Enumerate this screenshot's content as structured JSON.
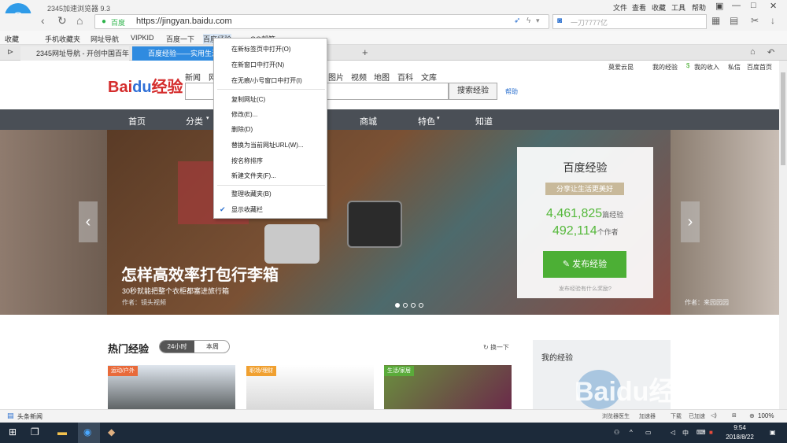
{
  "browser": {
    "title": "2345加速浏览器 9.3",
    "menu": [
      "文件",
      "查看",
      "收藏",
      "工具",
      "帮助"
    ],
    "url_status": "百度",
    "url": "https://jingyan.baidu.com",
    "search_placeholder": "一刀7777亿"
  },
  "bookmarks": [
    "收藏",
    "手机收藏夹",
    "网址导航",
    "VIPKID",
    "百度一下",
    "百度经验",
    "QQ邮箱"
  ],
  "tabs": [
    "2345网址导航 - 开创中国百年品牌",
    "百度经验——实用生活指南"
  ],
  "context_menu": {
    "items": [
      "在新标签页中打开(O)",
      "在新窗口中打开(N)",
      "在无痕/小号窗口中打开(I)",
      "复制网址(C)",
      "修改(E)...",
      "删除(D)",
      "替换为当前网址URL(W)...",
      "按名称排序",
      "新建文件夹(F)...",
      "整理收藏夹(B)",
      "显示收藏栏"
    ]
  },
  "page": {
    "logo_text": "Bai",
    "logo_du": "du",
    "logo_suffix": "经验",
    "nav_links": [
      "新闻",
      "网",
      "图片",
      "视频",
      "地图",
      "百科",
      "文库"
    ],
    "search_button": "搜索经验",
    "help": "帮助",
    "user_links": [
      "莫爱云昆",
      "我的经验",
      "我的收入",
      "私信",
      "百度首页"
    ],
    "dark_nav": [
      "首页",
      "分类",
      "商城",
      "特色",
      "知道"
    ],
    "hero": {
      "title": "怎样高效率打包行李箱",
      "subtitle": "30秒就能把整个衣柜都塞进旅行箱",
      "by": "作者：镜头视频",
      "author_right": "作者：来园园园"
    },
    "card": {
      "title": "百度经验",
      "slogan": "分享让生活更美好",
      "count1": "4,461,825",
      "count1_unit": "篇经验",
      "count2": "492,114",
      "count2_unit": "个作者",
      "publish": "发布经验",
      "note": "发布经验有什么奖励?"
    },
    "hot": {
      "title": "热门经验",
      "tab1": "24小时",
      "tab2": "本周",
      "refresh": "换一下",
      "tags": [
        "运动/户外",
        "职场/理财",
        "生活/家居"
      ]
    },
    "my_exp": "我的经验",
    "watermark": "Baidu经验"
  },
  "statusbar": {
    "news": "头条新闻",
    "items": [
      "浏览器医生",
      "加速器",
      "下载",
      "已加速"
    ],
    "zoom": "100%"
  },
  "taskbar": {
    "time": "9:54",
    "date": "2018/8/22",
    "ime": "中"
  },
  "colors": {
    "accent": "#2f8be0",
    "green": "#4caf35",
    "dark_nav": "#4a4f56",
    "logo_red": "#d42c2c"
  }
}
